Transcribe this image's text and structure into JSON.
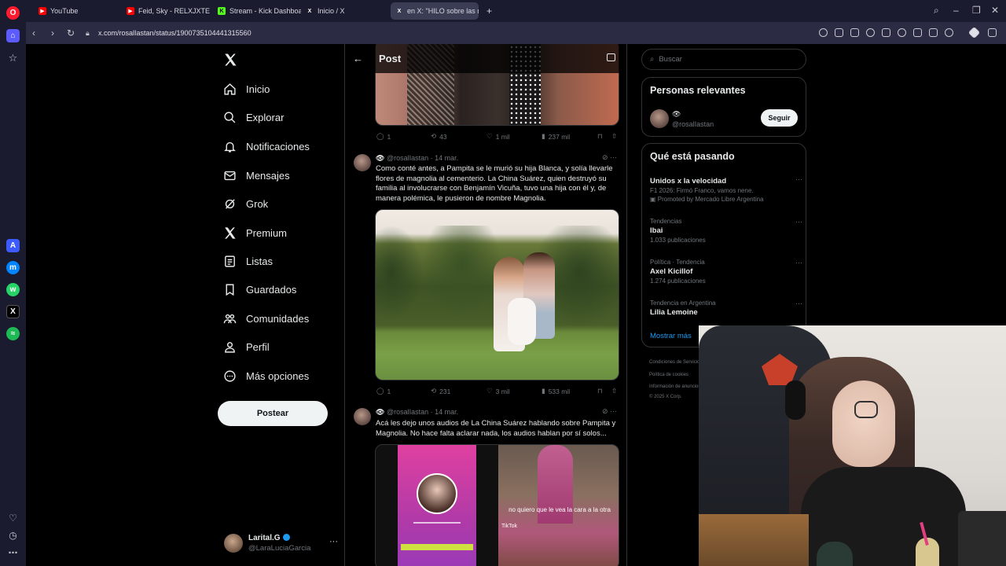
{
  "browser": {
    "tabs": [
      {
        "label": "YouTube",
        "color": "#ff0000"
      },
      {
        "label": "Feid, Sky - RELXJXTE - You",
        "color": "#ff0000"
      },
      {
        "label": "Stream - Kick Dashboard",
        "color": "#53fc18"
      },
      {
        "label": "Inicio / X",
        "color": "#ffffff"
      },
      {
        "label": "en X: \"HILO sobre las m",
        "color": "#ffffff"
      }
    ],
    "url": "x.com/rosalIastan/status/1900735104441315560"
  },
  "x_nav": {
    "items": [
      {
        "label": "Inicio",
        "icon": "home-icon"
      },
      {
        "label": "Explorar",
        "icon": "search-icon"
      },
      {
        "label": "Notificaciones",
        "icon": "bell-icon"
      },
      {
        "label": "Mensajes",
        "icon": "mail-icon"
      },
      {
        "label": "Grok",
        "icon": "grok-icon"
      },
      {
        "label": "Premium",
        "icon": "x-icon"
      },
      {
        "label": "Listas",
        "icon": "list-icon"
      },
      {
        "label": "Guardados",
        "icon": "bookmark-icon"
      },
      {
        "label": "Comunidades",
        "icon": "communities-icon"
      },
      {
        "label": "Perfil",
        "icon": "person-icon"
      },
      {
        "label": "Más opciones",
        "icon": "more-icon"
      }
    ],
    "post_button": "Postear",
    "account": {
      "name": "Larital.G",
      "handle": "@LaraLuciaGarcia"
    }
  },
  "post_header": {
    "title": "Post"
  },
  "tweets": [
    {
      "stats": {
        "replies": "1",
        "reposts": "43",
        "likes": "1 mil",
        "views": "237 mil"
      }
    },
    {
      "author_handle": "@rosalIastan",
      "date": "14 mar.",
      "text": "Como conté antes, a Pampita se le murió su hija Blanca, y solía llevarle flores de magnolia al cementerio. La China Suárez, quien destruyó su familia al involucrarse con Benjamín Vicuña, tuvo una hija con él y, de manera polémica, le pusieron de nombre Magnolia.",
      "stats": {
        "replies": "1",
        "reposts": "231",
        "likes": "3 mil",
        "views": "533 mil"
      }
    },
    {
      "author_handle": "@rosalIastan",
      "date": "14 mar.",
      "text": "Acá les dejo unos audios de La China Suárez hablando sobre Pampita y Magnolia. No hace falta aclarar nada, los audios hablan por sí solos...",
      "media_caption": "no quiero que le vea la cara a la otra",
      "media_brand": "TikTok"
    }
  ],
  "right": {
    "search_placeholder": "Buscar",
    "relevant_title": "Personas relevantes",
    "relevant_person": {
      "handle": "@rosalIastan",
      "follow_label": "Seguir"
    },
    "whats_happening_title": "Qué está pasando",
    "trends": [
      {
        "context": "",
        "title": "Unidos x la velocidad",
        "sub": "F1 2026: Firmó Franco, vamos nene.",
        "promo": "Promoted by Mercado Libre Argentina"
      },
      {
        "context": "Tendencias",
        "title": "Ibai",
        "sub": "1.033 publicaciones"
      },
      {
        "context": "Política · Tendencia",
        "title": "Axel Kicillof",
        "sub": "1.274 publicaciones"
      },
      {
        "context": "Tendencia en Argentina",
        "title": "Lilia Lemoine",
        "sub": ""
      }
    ],
    "show_more": "Mostrar más",
    "footer": [
      "Condiciones de Servicio",
      "Política de cookies",
      "Información de anuncios",
      "© 2025 X Corp."
    ]
  }
}
